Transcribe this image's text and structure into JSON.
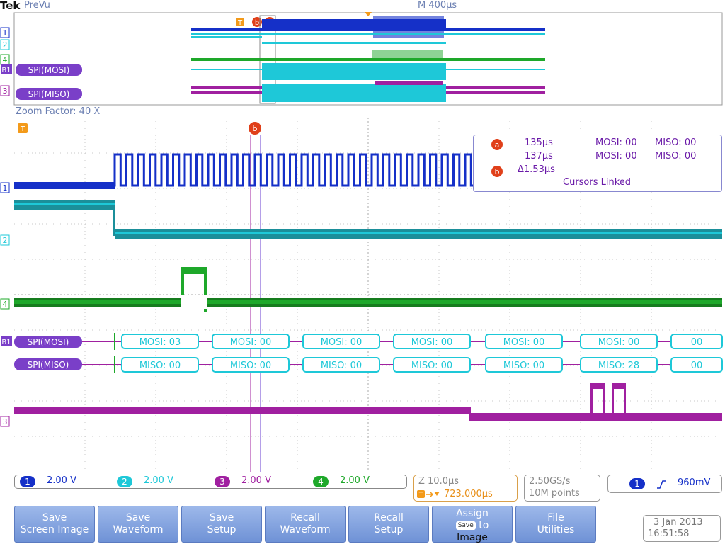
{
  "header": {
    "brand": "Tek",
    "mode": "PreVu",
    "timebase": "M 400µs"
  },
  "zoom": {
    "factor_label": "Zoom Factor: 40 X"
  },
  "markers": {
    "trigger": "T",
    "cursor_a": "a",
    "cursor_b": "b"
  },
  "channel_labels": {
    "ch1": "1",
    "ch2": "2",
    "ch3": "3",
    "ch4": "4",
    "b1": "B1"
  },
  "bus_labels": {
    "mosi": "SPI(MOSI)",
    "miso": "SPI(MISO)"
  },
  "decode": {
    "mosi": [
      "MOSI: 03",
      "MOSI: 00",
      "MOSI: 00",
      "MOSI: 00",
      "MOSI: 00",
      "MOSI: 00",
      "00"
    ],
    "miso": [
      "MISO: 00",
      "MISO: 00",
      "MISO: 00",
      "MISO: 00",
      "MISO: 00",
      "MISO: 28",
      "00"
    ]
  },
  "cursor_readout": {
    "a_time": "135µs",
    "a_mosi": "MOSI: 00",
    "a_miso": "MISO: 00",
    "b_time": "137µs",
    "b_mosi": "MOSI: 00",
    "b_miso": "MISO: 00",
    "delta": "Δ1.53µs",
    "linked": "Cursors Linked"
  },
  "channels": [
    {
      "num": "1",
      "scale": "2.00 V",
      "color": "#1530c8"
    },
    {
      "num": "2",
      "scale": "2.00 V",
      "color": "#1ec8d8"
    },
    {
      "num": "3",
      "scale": "2.00 V",
      "color": "#a020a0"
    },
    {
      "num": "4",
      "scale": "2.00 V",
      "color": "#1ea82a"
    }
  ],
  "zoom_info": {
    "scale": "Z 10.0µs",
    "position": "723.000µs"
  },
  "acquisition": {
    "rate": "2.50GS/s",
    "length": "10M points"
  },
  "trigger": {
    "source": "1",
    "slope_icon": "rising-edge-icon",
    "level": "960mV"
  },
  "softkeys": {
    "save_screen": [
      "Save",
      "Screen Image"
    ],
    "save_waveform": [
      "Save",
      "Waveform"
    ],
    "save_setup": [
      "Save",
      "Setup"
    ],
    "recall_waveform": [
      "Recall",
      "Waveform"
    ],
    "recall_setup": [
      "Recall",
      "Setup"
    ],
    "assign_save": [
      "Assign",
      "Save",
      "to",
      "Image"
    ],
    "file_utilities": [
      "File",
      "Utilities"
    ]
  },
  "datetime": {
    "date": "3 Jan  2013",
    "time": "16:51:58"
  }
}
